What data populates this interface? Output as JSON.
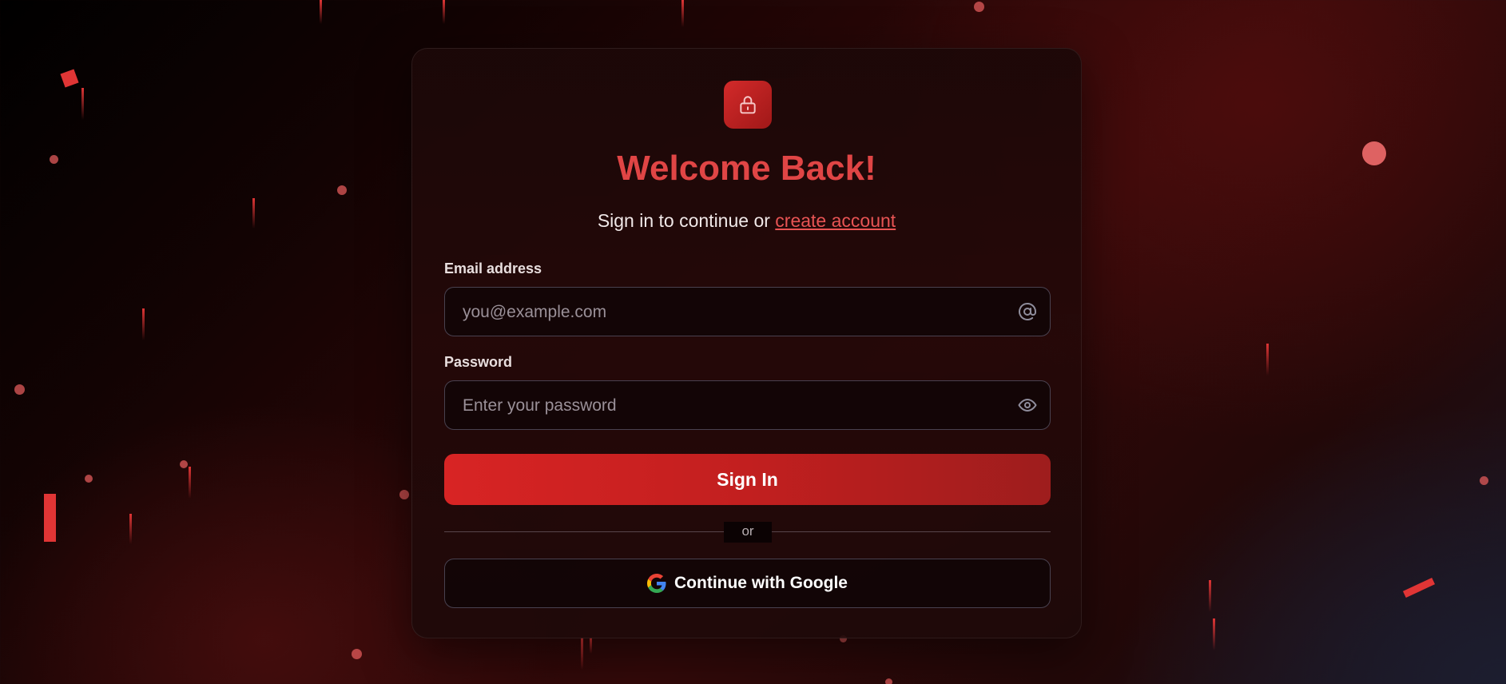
{
  "login": {
    "title": "Welcome Back!",
    "subtitle_prefix": "Sign in to continue or ",
    "create_account_link": "create account",
    "email": {
      "label": "Email address",
      "placeholder": "you@example.com",
      "value": "",
      "icon": "at-icon"
    },
    "password": {
      "label": "Password",
      "placeholder": "Enter your password",
      "value": "",
      "icon": "eye-icon"
    },
    "sign_in_button": "Sign In",
    "divider_text": "or",
    "google_button": "Continue with Google"
  },
  "theme": {
    "accent": "#e04545",
    "button_gradient_start": "#d82424",
    "button_gradient_end": "#9e1d1d",
    "background": "#1a0505"
  }
}
